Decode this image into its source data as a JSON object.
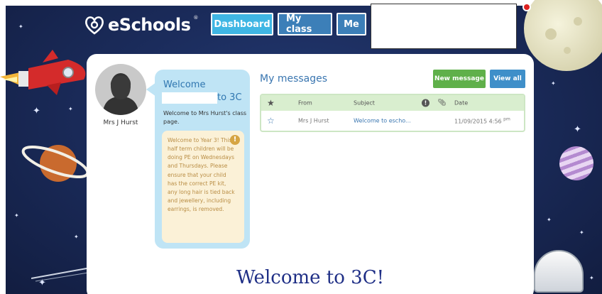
{
  "brand": {
    "logo_text": "eSchools"
  },
  "nav": {
    "dashboard": "Dashboard",
    "my_class": "My class",
    "me": "Me"
  },
  "profile": {
    "name": "Mrs J Hurst"
  },
  "welcome": {
    "title": "Welcome",
    "title_suffix": "to 3C",
    "text": "Welcome to Mrs Hurst's class page.",
    "notice": "Welcome to Year 3! This half term children will be doing PE on Wednesdays and Thursdays. Please ensure that your child has the correct PE kit, any long hair is tied back and jewellery, including earrings, is removed."
  },
  "messages": {
    "title": "My messages",
    "new_label": "New message",
    "view_all_label": "View all",
    "columns": {
      "from": "From",
      "subject": "Subject",
      "date": "Date"
    },
    "rows": [
      {
        "from": "Mrs J Hurst",
        "subject": "Welcome to escho...",
        "date": "11/09/2015 4:56",
        "date_suffix": "pm"
      }
    ]
  },
  "heading": "Welcome to 3C!",
  "colors": {
    "accent_blue": "#3fb6e4",
    "nav_dark": "#3c7fb8",
    "green": "#5fb04a",
    "heading": "#1f2f86"
  }
}
